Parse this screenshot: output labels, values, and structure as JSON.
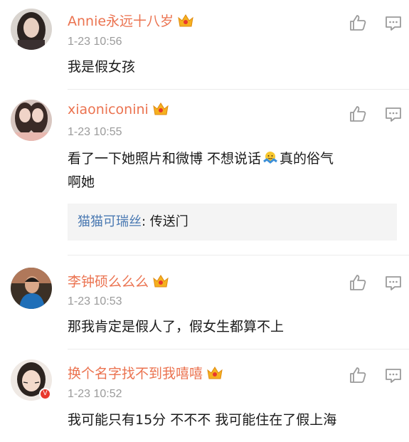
{
  "comments": [
    {
      "username": "Annie永远十八岁",
      "time": "1-23 10:56",
      "text": "我是假女孩",
      "avatar": "avatar-girl-1"
    },
    {
      "username": "xiaoniconini",
      "time": "1-23 10:55",
      "text_part1": "看了一下她照片和微博 不想说话",
      "text_part2": "真的俗气",
      "text_line2": "啊她",
      "emoji": "shrug-emoji",
      "reply_name": "猫猫可瑞丝",
      "reply_text": ": 传送门",
      "avatar": "avatar-girl-2"
    },
    {
      "username": "李钟硕么么么",
      "time": "1-23 10:53",
      "text": "那我肯定是假人了，假女生都算不上",
      "avatar": "avatar-boy"
    },
    {
      "username": "换个名字找不到我嘻嘻",
      "time": "1-23 10:52",
      "text": "我可能只有15分 不不不 我可能住在了假上海",
      "avatar": "avatar-girl-3",
      "badge": "V"
    }
  ],
  "colors": {
    "username": "#eb7350",
    "time": "#9b9b9b",
    "reply_name": "#4a79b2",
    "icon": "#9b9b9b"
  }
}
